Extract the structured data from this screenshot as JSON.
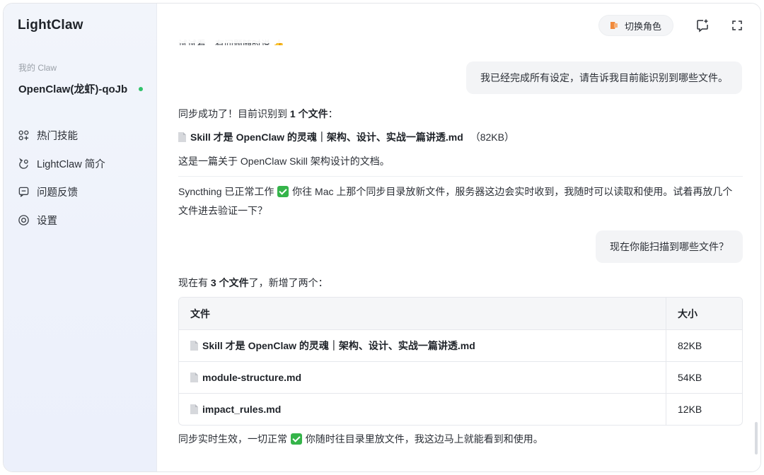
{
  "app": {
    "name": "LightClaw"
  },
  "sidebar": {
    "section_label": "我的 Claw",
    "agent_name": "OpenClaw(龙虾)-qoJb",
    "nav": [
      {
        "label": "热门技能",
        "icon": "sparkle-grid-icon"
      },
      {
        "label": "LightClaw 简介",
        "icon": "claw-icon"
      },
      {
        "label": "问题反馈",
        "icon": "feedback-chat-icon"
      },
      {
        "label": "设置",
        "icon": "settings-gear-icon"
      }
    ]
  },
  "topbar": {
    "role_switch_label": "切换角色",
    "icons": [
      "role-switch-icon",
      "new-chat-icon",
      "fullscreen-icon"
    ]
  },
  "conversation": {
    "partial_top": "试试看，有问题随时说 👍",
    "user_msg_1": "我已经完成所有设定，请告诉我目前能识别到哪些文件。",
    "reply_1": {
      "line1_pre": "同步成功了！目前识别到 ",
      "line1_bold": "1 个文件",
      "line1_post": "：",
      "file_name": "Skill 才是 OpenClaw 的灵魂｜架构、设计、实战一篇讲透.md",
      "file_size": "（82KB）",
      "line3": "这是一篇关于 OpenClaw Skill 架构设计的文档。",
      "line4_pre": "Syncthing 已正常工作",
      "line4_post": "你往 Mac 上那个同步目录放新文件，服务器这边会实时收到，我随时可以读取和使用。试着再放几个",
      "line5": "文件进去验证一下？"
    },
    "user_msg_2": "现在你能扫描到哪些文件？",
    "reply_2": {
      "intro_pre": "现在有 ",
      "intro_bold": "3 个文件",
      "intro_post": "了，新增了两个：",
      "table": {
        "headers": [
          "文件",
          "大小"
        ],
        "rows": [
          [
            "Skill 才是 OpenClaw 的灵魂｜架构、设计、实战一篇讲透.md",
            "82KB"
          ],
          [
            "module-structure.md",
            "54KB"
          ],
          [
            "impact_rules.md",
            "12KB"
          ]
        ]
      },
      "outro_pre": "同步实时生效，一切正常",
      "outro_post": "你随时往目录里放文件，我这边马上就能看到和使用。"
    }
  },
  "colors": {
    "accent_green": "#35b44a",
    "status_online": "#31c26a",
    "bubble_bg": "#f3f4f6"
  }
}
